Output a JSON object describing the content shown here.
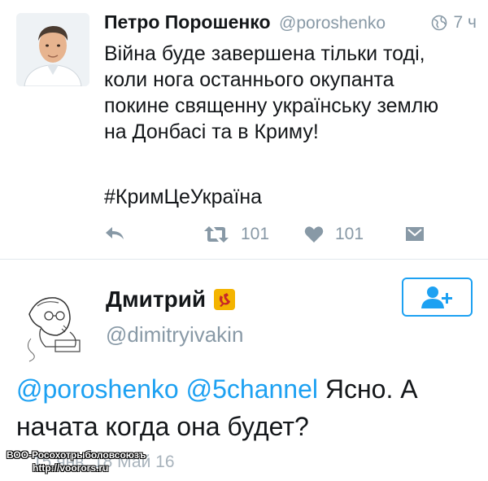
{
  "tweet": {
    "author_name": "Петро Порошенко",
    "author_handle": "@poroshenko",
    "time": "7 ч",
    "text_lines": [
      "Війна буде завершена тільки тоді,",
      "коли нога останнього окупанта",
      "покине священну українську землю",
      "на Донбасі та в Криму!"
    ],
    "hashtag": "#КримЦеУкраїна",
    "retweets": "101",
    "likes": "101",
    "colors": {
      "meta": "#8899a6",
      "divider": "#e1e8ed"
    }
  },
  "reply": {
    "author_name": "Дмитрий",
    "author_handle": "@dimitryivakin",
    "mention1": "@poroshenko",
    "mention2": "@5channel",
    "text_after_mentions": "Ясно. А",
    "text_line2": "начата когда она будет?",
    "timestamp": "15 янв. 18 Май 16",
    "colors": {
      "link": "#1da1f2",
      "emoji_bg": "#f4b400"
    }
  },
  "watermark": {
    "line1": "ВОО-Росохотрыболовсоюзъ",
    "line2": "http://voorors.ru"
  },
  "icons": [
    "globe-icon",
    "reply-icon",
    "retweet-icon",
    "heart-icon",
    "inbox-icon",
    "hammer-sickle-emoji",
    "follow-icon"
  ]
}
